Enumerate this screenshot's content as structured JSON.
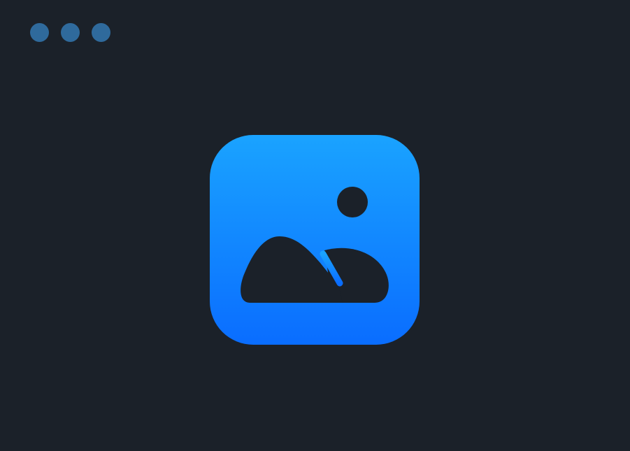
{
  "window": {
    "background": "#1b2129"
  },
  "window_controls": [
    {
      "name": "close",
      "color": "#2f6a9c"
    },
    {
      "name": "minimize",
      "color": "#2f6a9c"
    },
    {
      "name": "zoom",
      "color": "#2f6a9c"
    }
  ],
  "app_icon": {
    "icon": "image-photo-icon",
    "gradient_top": "#1aa3ff",
    "gradient_bottom": "#0a6dff",
    "glyph_color": "#1b2129"
  }
}
